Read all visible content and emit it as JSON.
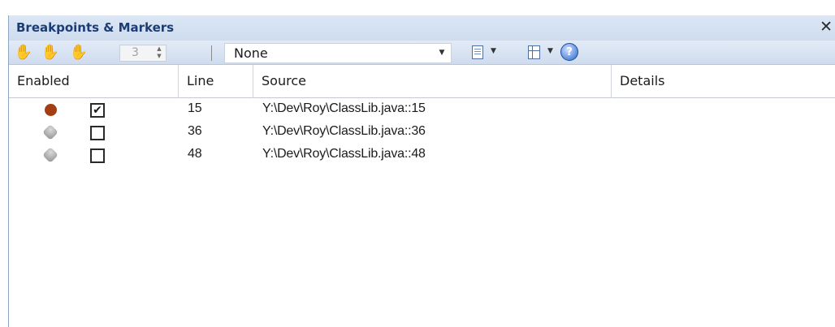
{
  "window": {
    "title": "Breakpoints & Markers",
    "close_glyph": "✕"
  },
  "toolbar": {
    "icons": [
      "hand-breakpoint-icon",
      "hand-marker-icon",
      "hand-outline-icon"
    ],
    "count_value": "3",
    "filter_value": "None",
    "help_glyph": "?"
  },
  "columns": [
    "Enabled",
    "Line",
    "Source",
    "Details"
  ],
  "rows": [
    {
      "enabled": true,
      "line": "15",
      "source": "Y:\\Dev\\Roy\\ClassLib.java::15",
      "details": ""
    },
    {
      "enabled": false,
      "line": "36",
      "source": "Y:\\Dev\\Roy\\ClassLib.java::36",
      "details": ""
    },
    {
      "enabled": false,
      "line": "48",
      "source": "Y:\\Dev\\Roy\\ClassLib.java::48",
      "details": ""
    }
  ],
  "colors": {
    "enabled_dot": "#a33d12",
    "title_text": "#1c3d74",
    "title_bg": "#dbe7f6"
  }
}
